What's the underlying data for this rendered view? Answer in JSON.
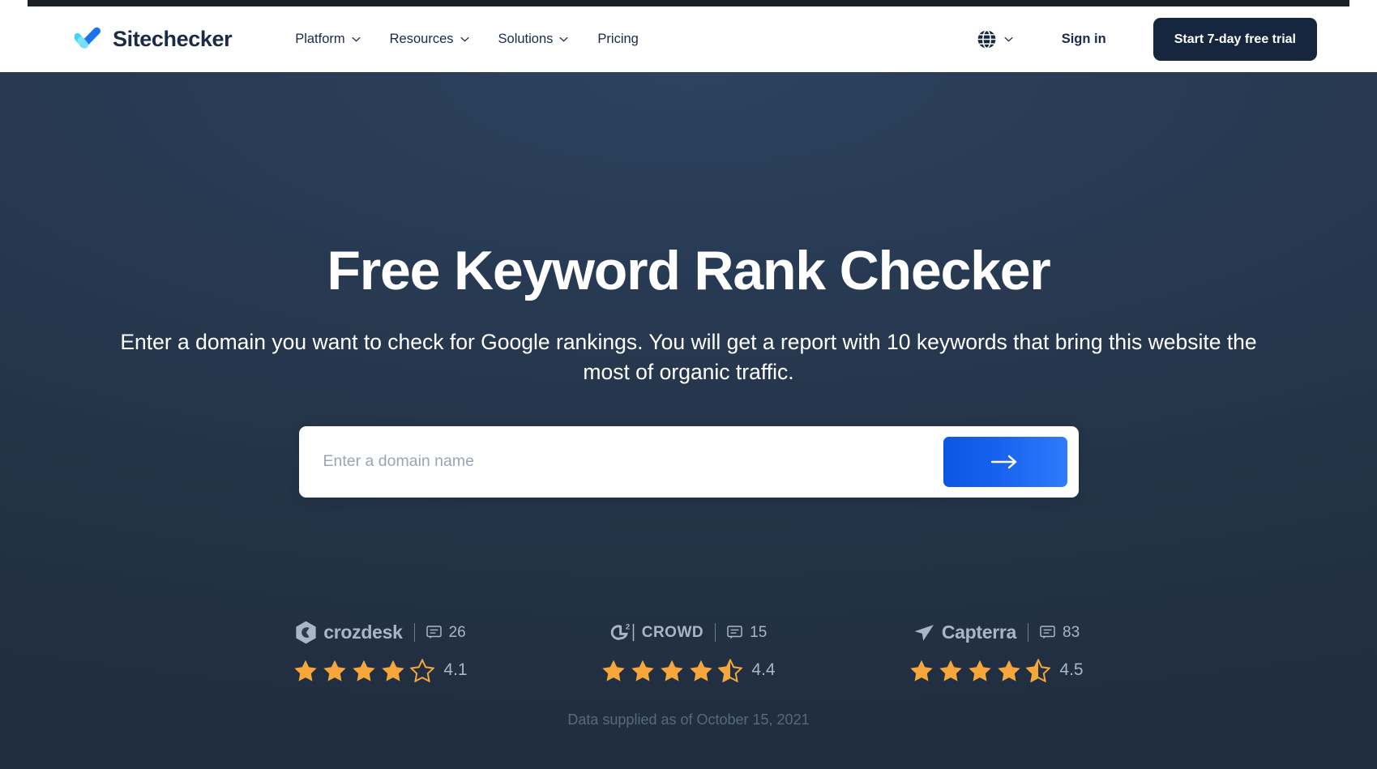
{
  "brand": {
    "name": "Sitechecker",
    "logo_icon": "double-check-logo",
    "color_light": "#3ad6f5",
    "color_dark": "#1a74f0"
  },
  "nav": {
    "items": [
      {
        "label": "Platform",
        "has_dropdown": true,
        "icon": "chevron-down-icon"
      },
      {
        "label": "Resources",
        "has_dropdown": true,
        "icon": "chevron-down-icon"
      },
      {
        "label": "Solutions",
        "has_dropdown": true,
        "icon": "chevron-down-icon"
      },
      {
        "label": "Pricing",
        "has_dropdown": false,
        "icon": ""
      }
    ]
  },
  "header_right": {
    "language_icon": "globe-icon",
    "language_chevron": "chevron-down-icon",
    "signin_label": "Sign in",
    "cta_label": "Start 7-day free trial",
    "cta_color": "#16263f"
  },
  "hero": {
    "title": "Free Keyword Rank Checker",
    "subtitle": "Enter a domain you want to check for Google rankings. You will get a report with 10 keywords that bring this website the most of organic traffic.",
    "background_color": "#27384f"
  },
  "search": {
    "placeholder": "Enter a domain name",
    "value": "",
    "submit_icon": "arrow-right-icon",
    "submit_color": "#1763ef"
  },
  "badges": [
    {
      "name": "crozdesk",
      "logo_icon": "crozdesk-hexagon-icon",
      "logo_text": "crozdesk",
      "review_icon": "speech-bubble-icon",
      "review_count": "26",
      "rating": "4.1",
      "stars_full": 4,
      "stars_half": 0,
      "stars_empty": 1
    },
    {
      "name": "g2crowd",
      "logo_icon": "g2-crowd-icon",
      "logo_text": "CROWD",
      "review_icon": "speech-bubble-icon",
      "review_count": "15",
      "rating": "4.4",
      "stars_full": 4,
      "stars_half": 1,
      "stars_empty": 0
    },
    {
      "name": "capterra",
      "logo_icon": "capterra-arrow-icon",
      "logo_text": "Capterra",
      "review_icon": "speech-bubble-icon",
      "review_count": "83",
      "rating": "4.5",
      "stars_full": 4,
      "stars_half": 1,
      "stars_empty": 0
    }
  ],
  "footer_note": "Data supplied as of October 15, 2021",
  "colors": {
    "star_fill": "#f5a73b",
    "muted_text": "#aab6c6",
    "note_text": "#56697f"
  }
}
